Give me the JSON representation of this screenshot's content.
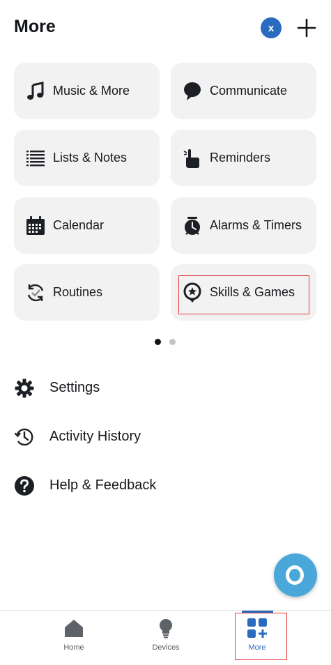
{
  "header": {
    "title": "More",
    "avatar_letter": "x",
    "add_icon": "plus-icon"
  },
  "tiles": [
    {
      "label": "Music & More",
      "icon": "music-note-icon"
    },
    {
      "label": "Communicate",
      "icon": "speech-bubble-icon"
    },
    {
      "label": "Lists & Notes",
      "icon": "list-icon"
    },
    {
      "label": "Reminders",
      "icon": "pointing-hand-icon"
    },
    {
      "label": "Calendar",
      "icon": "calendar-icon"
    },
    {
      "label": "Alarms & Timers",
      "icon": "alarm-clock-icon"
    },
    {
      "label": "Routines",
      "icon": "routines-icon"
    },
    {
      "label": "Skills & Games",
      "icon": "skills-games-icon"
    }
  ],
  "pager": {
    "pages": 2,
    "current": 1
  },
  "menu": [
    {
      "label": "Settings",
      "icon": "gear-icon"
    },
    {
      "label": "Activity History",
      "icon": "history-icon"
    },
    {
      "label": "Help & Feedback",
      "icon": "help-icon"
    }
  ],
  "bottom_nav": [
    {
      "label": "Home",
      "icon": "home-icon"
    },
    {
      "label": "Devices",
      "icon": "lightbulb-icon"
    },
    {
      "label": "More",
      "icon": "more-grid-icon",
      "active": true
    }
  ],
  "colors": {
    "accent": "#2a6bbf",
    "tile_bg": "#f2f2f2",
    "alexa_button": "#4aa7d9",
    "highlight": "#e23b3b"
  }
}
